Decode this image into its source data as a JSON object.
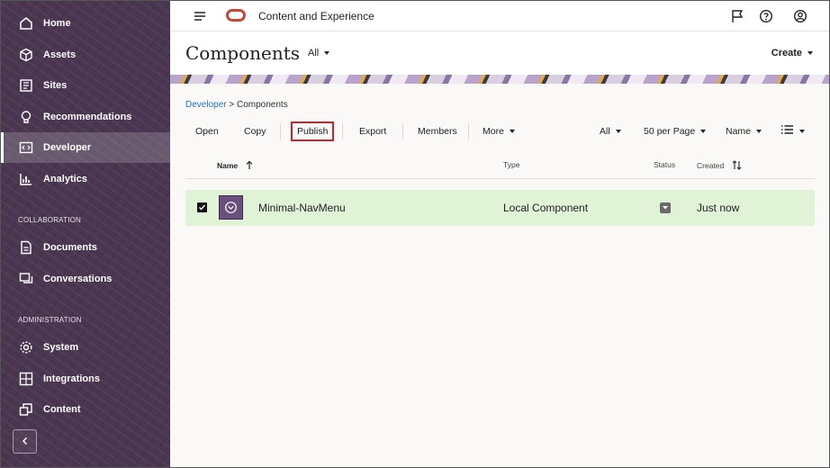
{
  "app": {
    "title": "Content and Experience",
    "brand_color": "#c74634"
  },
  "sidebar": {
    "items": [
      {
        "label": "Home",
        "icon": "home-icon"
      },
      {
        "label": "Assets",
        "icon": "cube-icon"
      },
      {
        "label": "Sites",
        "icon": "sites-icon"
      },
      {
        "label": "Recommendations",
        "icon": "lightbulb-icon"
      },
      {
        "label": "Developer",
        "icon": "code-icon",
        "active": true
      },
      {
        "label": "Analytics",
        "icon": "analytics-icon"
      }
    ],
    "collaboration_label": "COLLABORATION",
    "collaboration_items": [
      {
        "label": "Documents",
        "icon": "document-icon"
      },
      {
        "label": "Conversations",
        "icon": "conversation-icon"
      }
    ],
    "administration_label": "ADMINISTRATION",
    "administration_items": [
      {
        "label": "System",
        "icon": "gear-icon"
      },
      {
        "label": "Integrations",
        "icon": "integrations-icon"
      },
      {
        "label": "Content",
        "icon": "content-icon"
      }
    ]
  },
  "header": {
    "page_title": "Components",
    "filter_label": "All",
    "create_label": "Create"
  },
  "breadcrumb": {
    "parent": "Developer",
    "separator": ">",
    "current": "Components"
  },
  "toolbar": {
    "open": "Open",
    "copy": "Copy",
    "publish": "Publish",
    "export": "Export",
    "members": "Members",
    "more": "More",
    "filter": "All",
    "per_page": "50 per Page",
    "sort": "Name"
  },
  "table": {
    "columns": {
      "name": "Name",
      "type": "Type",
      "status": "Status",
      "created": "Created"
    },
    "rows": [
      {
        "name": "Minimal-NavMenu",
        "type": "Local Component",
        "created": "Just now",
        "selected": true
      }
    ]
  }
}
